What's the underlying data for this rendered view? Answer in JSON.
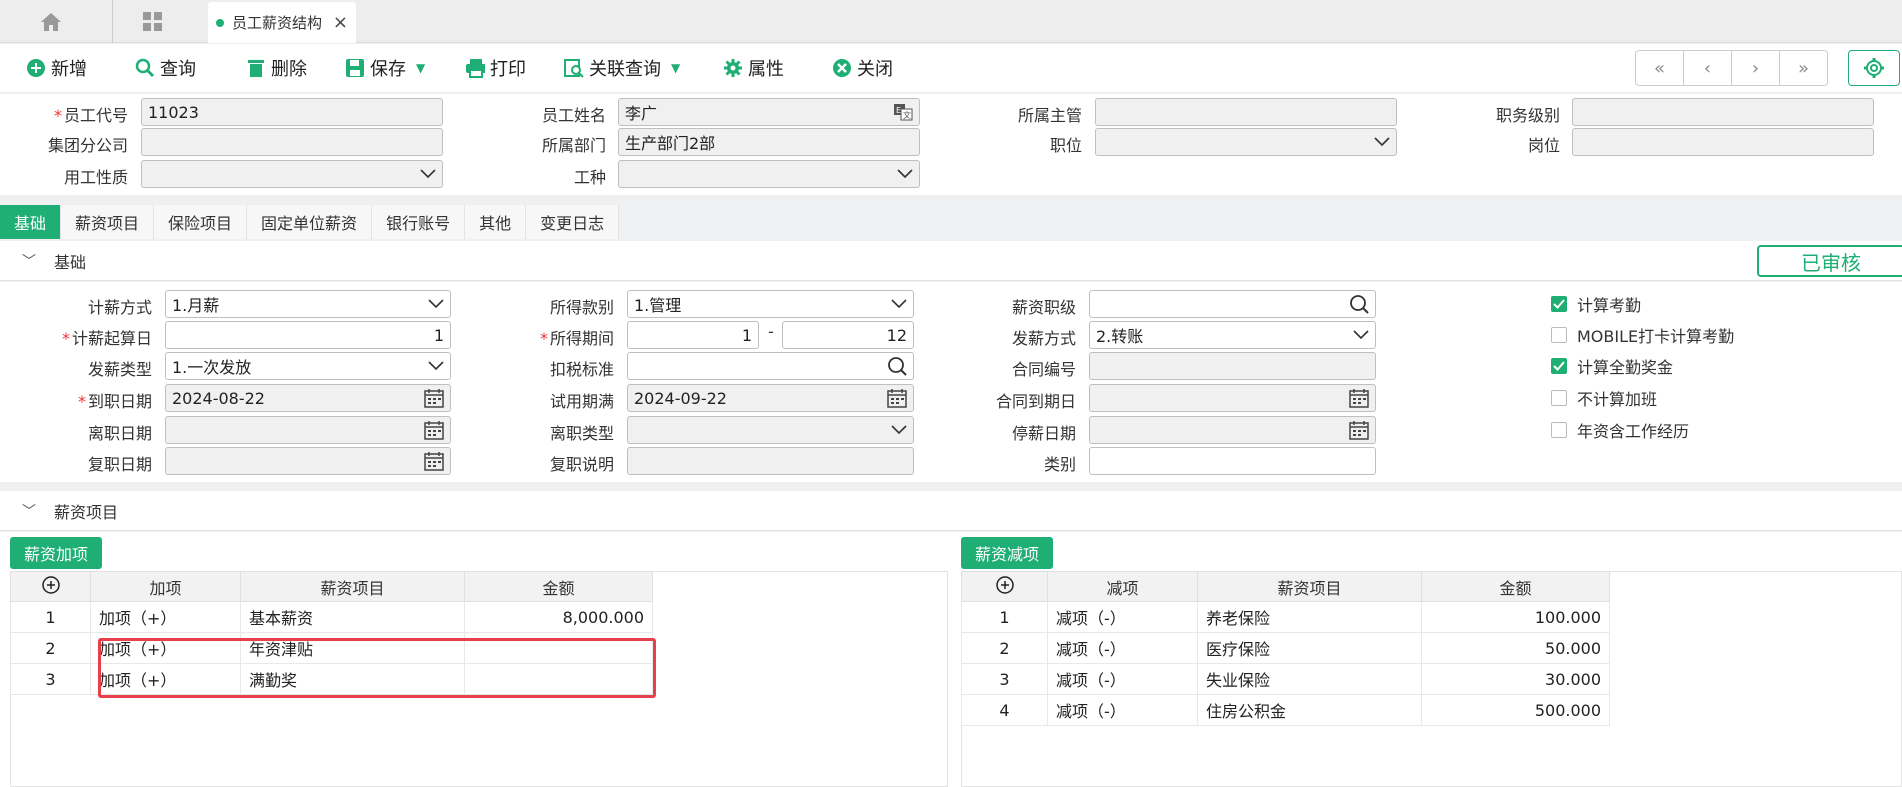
{
  "tabs": {
    "active_label": "员工薪资结构",
    "close_glyph": "×"
  },
  "toolbar": {
    "new": "新增",
    "search": "查询",
    "delete": "删除",
    "save": "保存",
    "print": "打印",
    "related": "关联查询",
    "properties": "属性",
    "close": "关闭",
    "nav": [
      "«",
      "‹",
      "›",
      "»"
    ]
  },
  "header": {
    "emp_code_label": "员工代号",
    "emp_code": "11023",
    "emp_name_label": "员工姓名",
    "emp_name": "李广",
    "manager_label": "所属主管",
    "manager": "",
    "job_grade_label": "职务级别",
    "job_grade": "",
    "branch_label": "集团分公司",
    "branch": "",
    "dept_label": "所属部门",
    "dept": "生产部门2部",
    "position_label": "职位",
    "position": "",
    "post_label": "岗位",
    "post": "",
    "emp_type_label": "用工性质",
    "emp_type": "",
    "work_type_label": "工种",
    "work_type": ""
  },
  "section_tabs": [
    "基础",
    "薪资项目",
    "保险项目",
    "固定单位薪资",
    "银行账号",
    "其他",
    "变更日志"
  ],
  "basic": {
    "title": "基础",
    "status": "已审核",
    "pay_method_label": "计薪方式",
    "pay_method": "1.月薪",
    "start_day_label": "计薪起算日",
    "start_day": "1",
    "pay_type_label": "发薪类型",
    "pay_type": "1.一次发放",
    "hire_date_label": "到职日期",
    "hire_date": "2024-08-22",
    "leave_date_label": "离职日期",
    "leave_date": "",
    "rehire_date_label": "复职日期",
    "rehire_date": "",
    "income_cat_label": "所得款别",
    "income_cat": "1.管理",
    "income_period_label": "所得期间",
    "income_period_from": "1",
    "income_period_to": "12",
    "period_sep": "-",
    "tax_std_label": "扣税标准",
    "tax_std": "",
    "probation_label": "试用期满",
    "probation": "2024-09-22",
    "leave_type_label": "离职类型",
    "leave_type": "",
    "rehire_note_label": "复职说明",
    "rehire_note": "",
    "salary_grade_label": "薪资职级",
    "salary_grade": "",
    "pay_mode_label": "发薪方式",
    "pay_mode": "2.转账",
    "contract_no_label": "合同编号",
    "contract_no": "",
    "contract_end_label": "合同到期日",
    "contract_end": "",
    "suspend_date_label": "停薪日期",
    "suspend_date": "",
    "category_label": "类别",
    "category": "",
    "checks": [
      {
        "label": "计算考勤",
        "checked": true
      },
      {
        "label": "MOBILE打卡计算考勤",
        "checked": false
      },
      {
        "label": "计算全勤奖金",
        "checked": true
      },
      {
        "label": "不计算加班",
        "checked": false
      },
      {
        "label": "年资含工作经历",
        "checked": false
      }
    ]
  },
  "salary": {
    "title": "薪资项目",
    "add_btn": "薪资加项",
    "sub_btn": "薪资减项",
    "add_cols": [
      "加项",
      "薪资项目",
      "金额"
    ],
    "sub_cols": [
      "减项",
      "薪资项目",
      "金额"
    ],
    "add_rows": [
      {
        "no": "1",
        "type": "加项（+）",
        "item": "基本薪资",
        "amount": "8,000.000"
      },
      {
        "no": "2",
        "type": "加项（+）",
        "item": "年资津贴",
        "amount": ""
      },
      {
        "no": "3",
        "type": "加项（+）",
        "item": "满勤奖",
        "amount": ""
      }
    ],
    "sub_rows": [
      {
        "no": "1",
        "type": "减项（-）",
        "item": "养老保险",
        "amount": "100.000"
      },
      {
        "no": "2",
        "type": "减项（-）",
        "item": "医疗保险",
        "amount": "50.000"
      },
      {
        "no": "3",
        "type": "减项（-）",
        "item": "失业保险",
        "amount": "30.000"
      },
      {
        "no": "4",
        "type": "减项（-）",
        "item": "住房公积金",
        "amount": "500.000"
      }
    ]
  }
}
